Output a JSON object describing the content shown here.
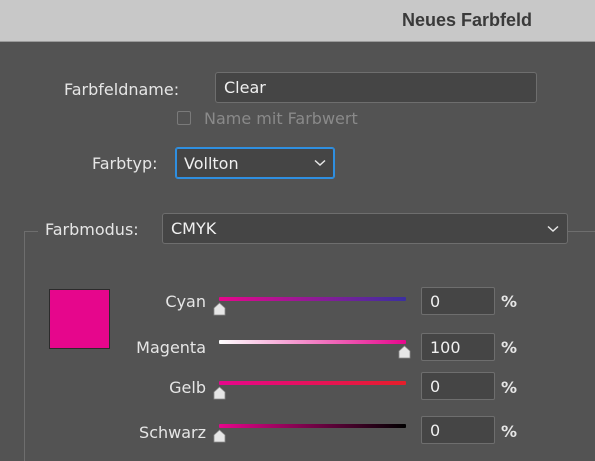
{
  "window": {
    "title": "Neues Farbfeld"
  },
  "swatch_name": {
    "label": "Farbfeldname:",
    "value": "Clear"
  },
  "name_with_value": {
    "label": "Name mit Farbwert",
    "checked": false
  },
  "color_type": {
    "label": "Farbtyp:",
    "value": "Vollton"
  },
  "color_mode": {
    "label": "Farbmodus:",
    "value": "CMYK"
  },
  "preview_color": "#e6068c",
  "sliders": [
    {
      "label": "Cyan",
      "value": "0",
      "unit": "%"
    },
    {
      "label": "Magenta",
      "value": "100",
      "unit": "%"
    },
    {
      "label": "Gelb",
      "value": "0",
      "unit": "%"
    },
    {
      "label": "Schwarz",
      "value": "0",
      "unit": "%"
    }
  ],
  "icons": {
    "dropdown": "chevron-down-icon",
    "slider_thumb": "slider-thumb-icon"
  }
}
